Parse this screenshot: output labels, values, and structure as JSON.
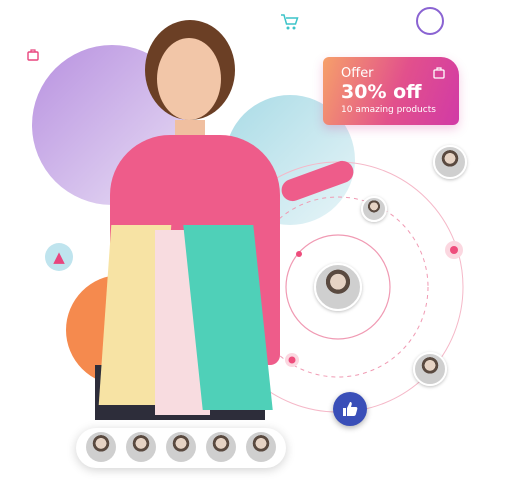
{
  "offer": {
    "label": "Offer",
    "discount": "30% off",
    "subtitle": "10 amazing products",
    "icon": "shopping-bag-icon"
  },
  "icons": {
    "cart": "shopping-cart-icon",
    "bag": "shopping-bag-icon",
    "like": "thumbs-up-icon",
    "dress": "dress-icon"
  },
  "colors": {
    "accent": "#e8457e",
    "like_button": "#3a4fb8",
    "offer_start": "#f6a06a",
    "offer_end": "#d13aa6"
  },
  "avatars_count": 5
}
